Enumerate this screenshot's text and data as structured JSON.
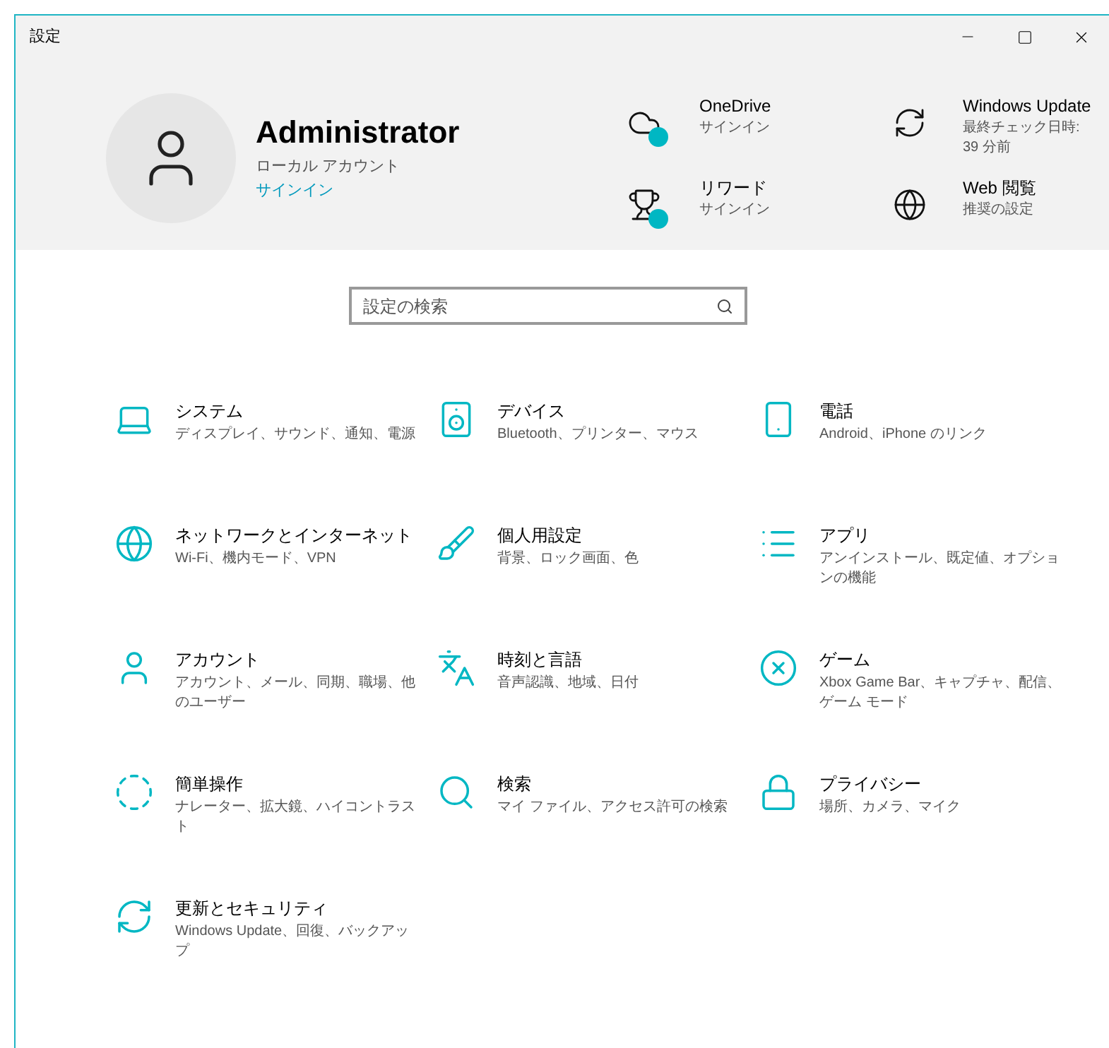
{
  "window": {
    "title": "設定"
  },
  "account": {
    "name": "Administrator",
    "type": "ローカル アカウント",
    "link": "サインイン"
  },
  "services": [
    {
      "title": "OneDrive",
      "subtitle": "サインイン",
      "badge": true
    },
    {
      "title": "Windows Update",
      "subtitle": "最終チェック日時: 39 分前",
      "badge": false
    },
    {
      "title": "リワード",
      "subtitle": "サインイン",
      "badge": true
    },
    {
      "title": "Web 閲覧",
      "subtitle": "推奨の設定",
      "badge": false
    }
  ],
  "search": {
    "placeholder": "設定の検索"
  },
  "categories": [
    {
      "title": "システム",
      "description": "ディスプレイ、サウンド、通知、電源"
    },
    {
      "title": "デバイス",
      "description": "Bluetooth、プリンター、マウス"
    },
    {
      "title": "電話",
      "description": "Android、iPhone のリンク"
    },
    {
      "title": "ネットワークとインターネット",
      "description": "Wi-Fi、機内モード、VPN"
    },
    {
      "title": "個人用設定",
      "description": "背景、ロック画面、色"
    },
    {
      "title": "アプリ",
      "description": "アンインストール、既定値、オプションの機能"
    },
    {
      "title": "アカウント",
      "description": "アカウント、メール、同期、職場、他のユーザー"
    },
    {
      "title": "時刻と言語",
      "description": "音声認識、地域、日付"
    },
    {
      "title": "ゲーム",
      "description": "Xbox Game Bar、キャプチャ、配信、ゲーム モード"
    },
    {
      "title": "簡単操作",
      "description": "ナレーター、拡大鏡、ハイコントラスト"
    },
    {
      "title": "検索",
      "description": "マイ ファイル、アクセス許可の検索"
    },
    {
      "title": "プライバシー",
      "description": "場所、カメラ、マイク"
    },
    {
      "title": "更新とセキュリティ",
      "description": "Windows Update、回復、バックアップ"
    }
  ]
}
